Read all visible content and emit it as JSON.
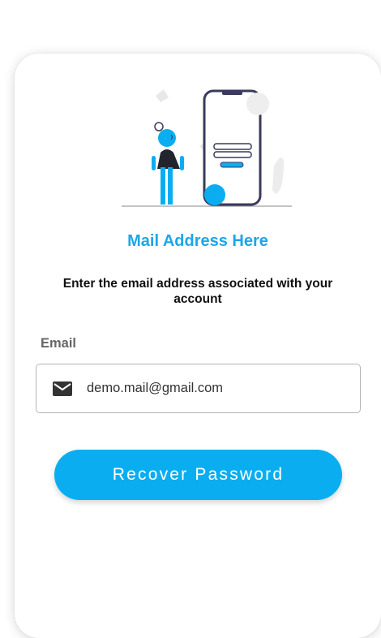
{
  "recover": {
    "title": "Mail Address Here",
    "subtitle": "Enter the email address associated with your account",
    "email_label": "Email",
    "email_value": "demo.mail@gmail.com",
    "email_icon": "mail-icon",
    "button_label": "Recover Password"
  },
  "colors": {
    "accent": "#0aaef0",
    "title": "#1aa7e8",
    "phone_outline": "#3a3a5a"
  }
}
